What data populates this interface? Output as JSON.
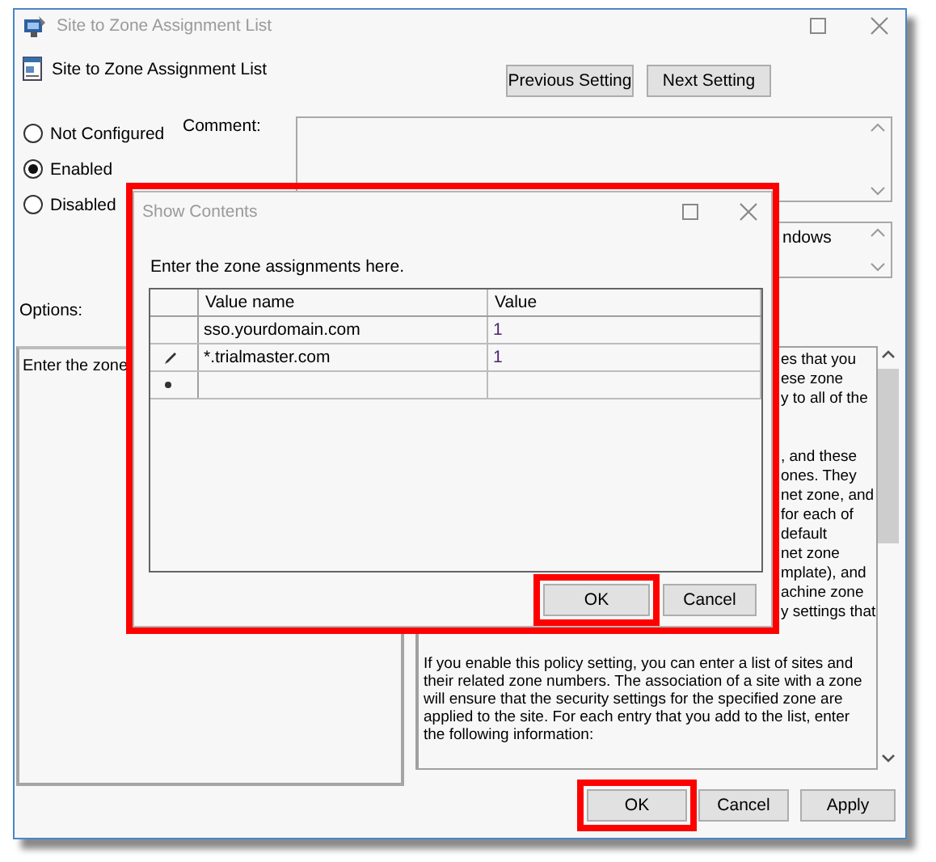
{
  "window": {
    "title": "Site to Zone Assignment List"
  },
  "header": {
    "title": "Site to Zone Assignment List",
    "buttons": [
      {
        "label": "Previous Setting"
      },
      {
        "label": "Next Setting"
      }
    ]
  },
  "state_options": [
    {
      "label": "Not Configured",
      "selected": false
    },
    {
      "label": "Enabled",
      "selected": true
    },
    {
      "label": "Disabled",
      "selected": false
    }
  ],
  "comment": {
    "label": "Comment:"
  },
  "supported_on": {
    "value": "ndows"
  },
  "options": {
    "label": "Options:",
    "text": "Enter the zone"
  },
  "help": {
    "fragments": [
      [
        "es that you",
        "ese zone",
        "y to all of the"
      ],
      [
        ", and these",
        "ones. They",
        "net zone, and",
        "for each of",
        "default",
        "net zone",
        "mplate), and",
        "achine zone",
        "y settings that"
      ]
    ],
    "paragraph": "If you enable this policy setting, you can enter a list of sites and their related zone numbers. The association of a site with a zone will ensure that the security settings for the specified zone are applied to the site.  For each entry that you add to the list, enter the following information:"
  },
  "buttons": [
    {
      "label": "OK",
      "highlighted": true
    },
    {
      "label": "Cancel",
      "highlighted": false
    },
    {
      "label": "Apply",
      "highlighted": false
    }
  ],
  "dialog": {
    "title": "Show Contents",
    "highlighted": true,
    "prompt": "Enter the zone assignments here.",
    "table": {
      "columns": [
        "Value name",
        "Value"
      ],
      "rows": [
        {
          "kind": "data",
          "value_name": "sso.yourdomain.com",
          "value": "1"
        },
        {
          "kind": "editing",
          "value_name": "*.trialmaster.com",
          "value": "1"
        },
        {
          "kind": "new"
        }
      ]
    },
    "buttons": [
      {
        "label": "OK",
        "highlighted": true
      },
      {
        "label": "Cancel",
        "highlighted": false
      }
    ]
  }
}
